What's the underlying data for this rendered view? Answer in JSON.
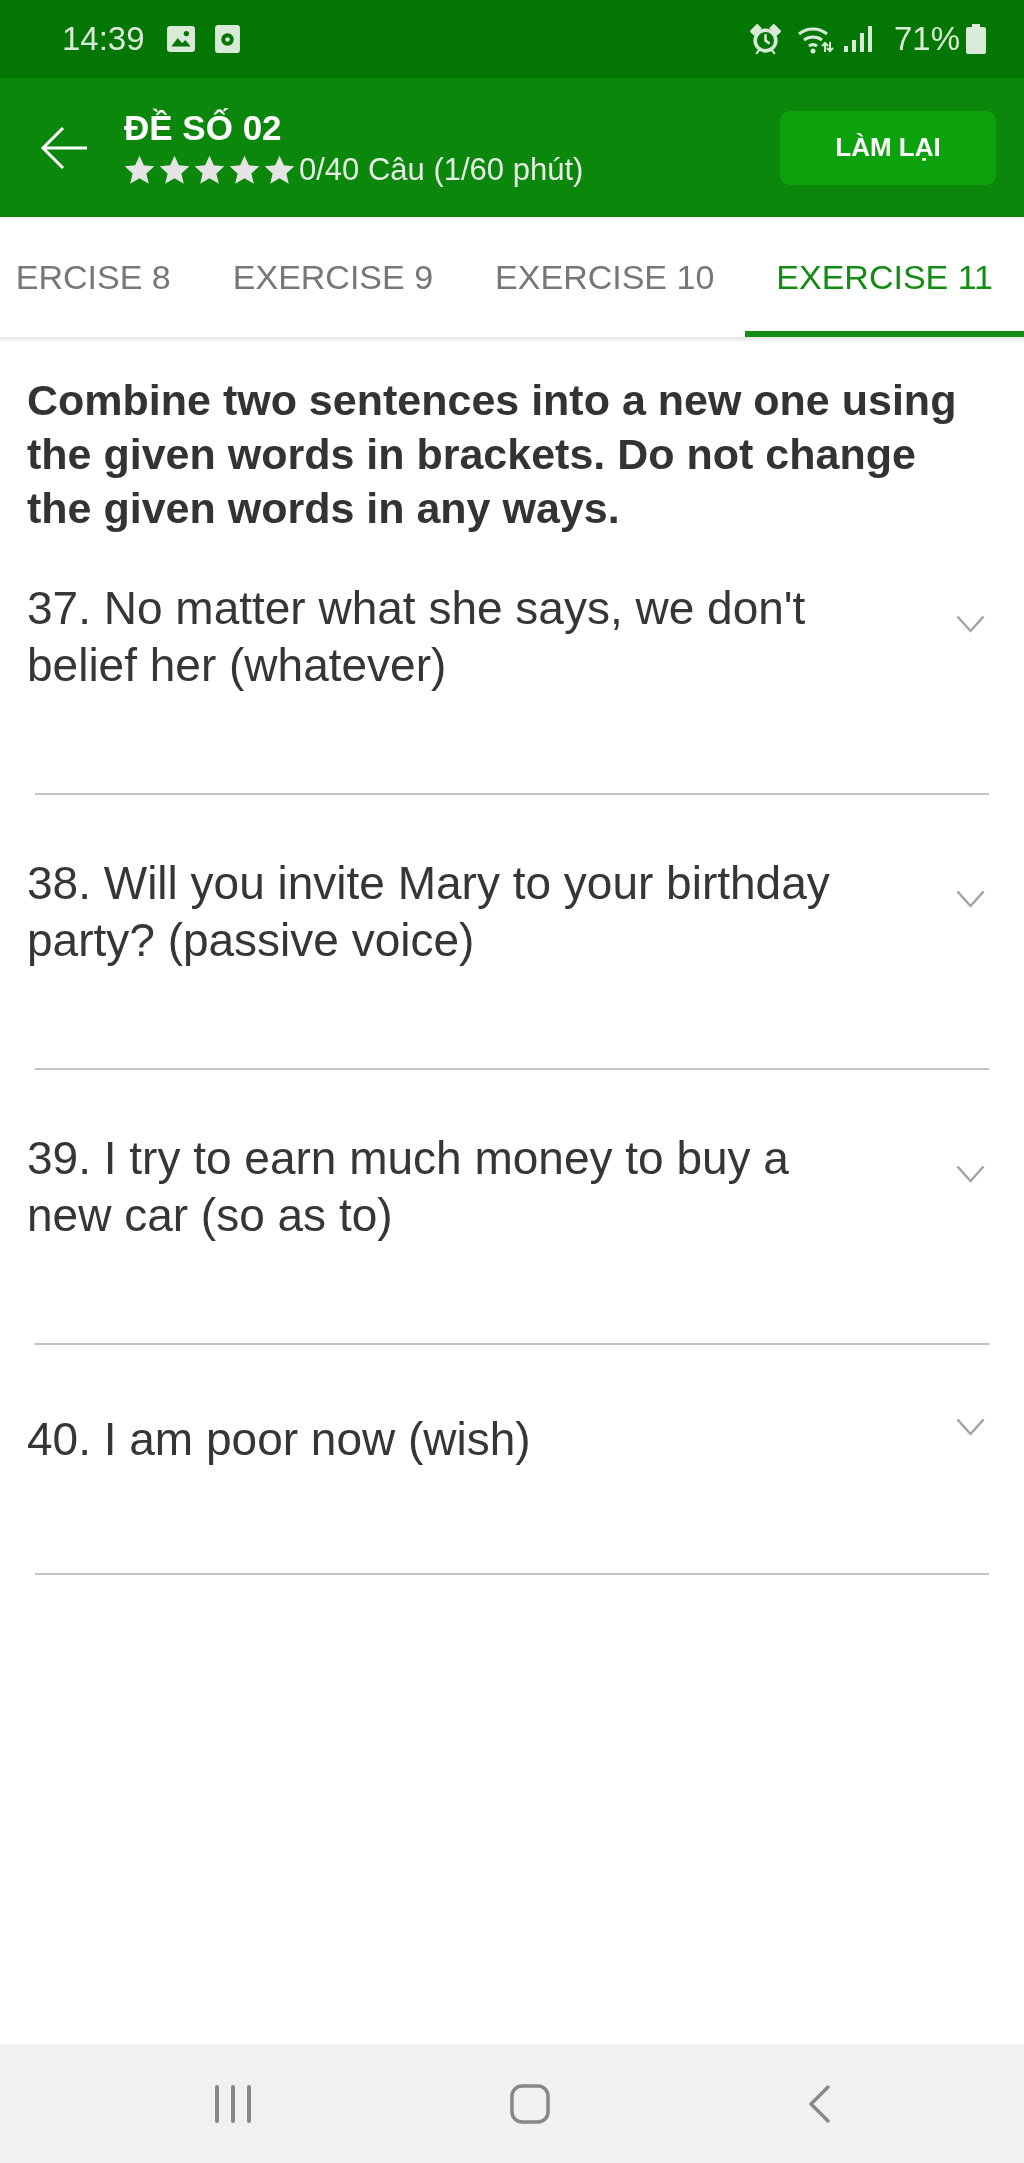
{
  "status_bar": {
    "time": "14:39",
    "battery": "71%"
  },
  "header": {
    "title": "ĐỀ SỐ 02",
    "stars": 5,
    "progress": "0/40 Câu (1/60 phút)",
    "action": "LÀM LẠI"
  },
  "tabs": [
    {
      "label": "ERCISE 8",
      "selected": false
    },
    {
      "label": "EXERCISE 9",
      "selected": false
    },
    {
      "label": "EXERCISE 10",
      "selected": false
    },
    {
      "label": "EXERCISE 11",
      "selected": true
    }
  ],
  "instruction": "Combine two sentences into a new one using the given words in brackets. Do not change the given words in any ways.",
  "questions": [
    {
      "text": "37. No matter what she says, we don't belief her (whatever)",
      "expanded": false
    },
    {
      "text": "38. Will you invite Mary to your birthday party? (passive voice)",
      "expanded": false
    },
    {
      "text": "39. I try to earn much money to buy a new car (so as to)",
      "expanded": false
    },
    {
      "text": "40. I am poor now (wish)",
      "expanded": false
    }
  ]
}
